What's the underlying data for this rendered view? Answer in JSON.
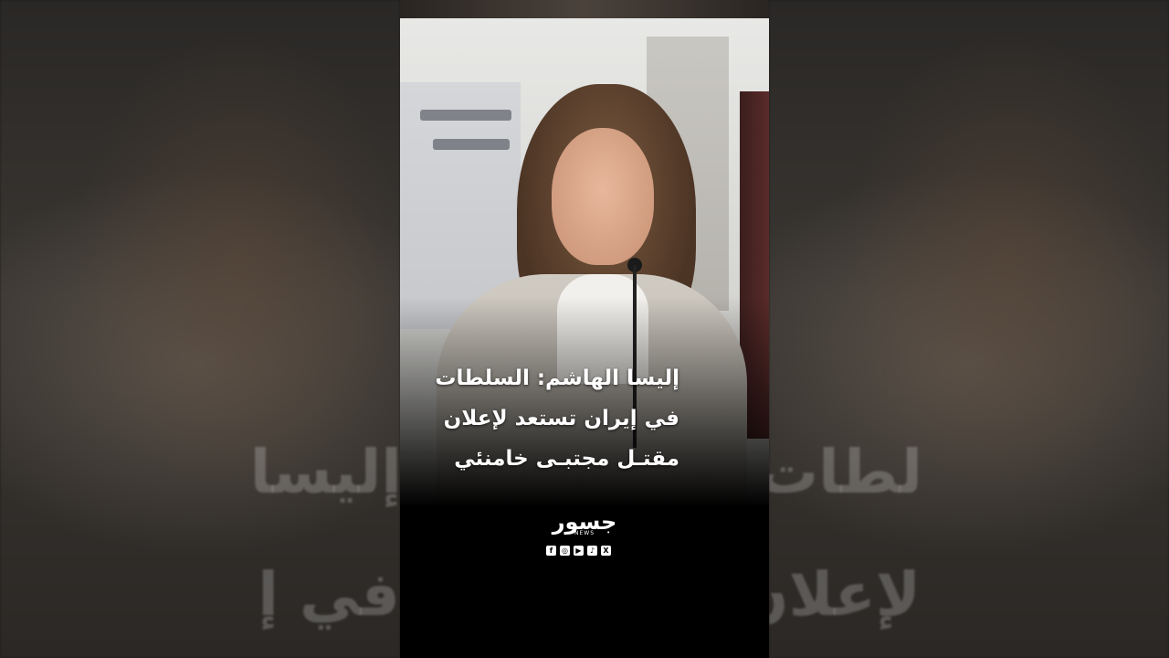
{
  "headline": {
    "line1": "إليسا الهاشم: السلطات",
    "line2": "في إيران تستعد لإعلان",
    "line3": "مقتـل مجتبـى خامنئي"
  },
  "background_ghost": {
    "left_line1": "إليسا",
    "left_line2": "في إ",
    "right_line1": "لطات",
    "right_line2": "لإعلان"
  },
  "brand": {
    "name": "جسور",
    "sub": "NEWS"
  },
  "socials": [
    {
      "icon": "facebook-icon",
      "glyph": "f"
    },
    {
      "icon": "instagram-icon",
      "glyph": "◎"
    },
    {
      "icon": "youtube-icon",
      "glyph": "▶"
    },
    {
      "icon": "tiktok-icon",
      "glyph": "♪"
    },
    {
      "icon": "x-icon",
      "glyph": "X"
    }
  ]
}
